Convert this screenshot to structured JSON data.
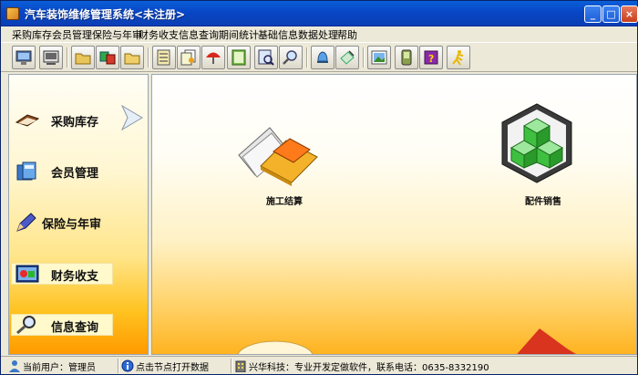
{
  "window": {
    "title": "汽车装饰维修管理系统<未注册>",
    "controls": {
      "minimize": "_",
      "maximize": "□",
      "close": "×"
    }
  },
  "menu": [
    "采购库存",
    "会员管理",
    "保险与年审",
    "财务收支",
    "信息查询",
    "期间统计",
    "基础信息",
    "数据处理",
    "帮助"
  ],
  "toolbar": {
    "buttons": [
      "monitor-icon",
      "screen-icon",
      "folder-icon",
      "card-exchange-icon",
      "folder-open-icon",
      "ledger-icon",
      "docs-icon",
      "umbrella-icon",
      "notebook-icon",
      "search-doc-icon",
      "magnifier-icon",
      "bell-icon",
      "pen-note-icon",
      "picture-icon",
      "pda-icon",
      "help-book-icon",
      "exit-runner-icon"
    ]
  },
  "nav": {
    "items": [
      {
        "label": "采购库存",
        "icon": "book-icon"
      },
      {
        "label": "会员管理",
        "icon": "member-icon"
      },
      {
        "label": "保险与年审",
        "icon": "pen-icon"
      },
      {
        "label": "财务收支",
        "icon": "finance-icon"
      },
      {
        "label": "信息查询",
        "icon": "search-icon"
      }
    ]
  },
  "main": {
    "items": [
      {
        "label": "施工结算",
        "icon": "folder-stack-icon"
      },
      {
        "label": "配件销售",
        "icon": "cube-icon"
      }
    ]
  },
  "status": {
    "user": "当前用户：管理员",
    "hint": "点击节点打开数据",
    "company": "兴华科技：专业开发定做软件，联系电话：0635-8332190"
  },
  "colors": {
    "titlebar": "#0846c6",
    "accent_orange": "#ffb320",
    "cube_green": "#3fbf3f"
  }
}
